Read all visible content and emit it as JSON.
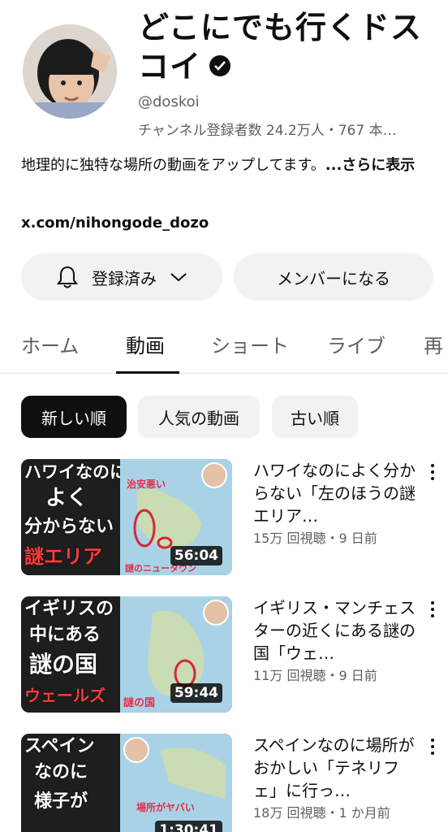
{
  "channel": {
    "name": "どこにでも行くドスコイ",
    "handle": "@doskoi",
    "stats": "チャンネル登録者数 24.2万人・767 本…",
    "description": "地理的に独特な場所の動画をアップしてます。",
    "more_label": "...さらに表示",
    "link": "x.com/nihongode_dozo"
  },
  "actions": {
    "subscribed_label": "登録済み",
    "member_label": "メンバーになる"
  },
  "tabs": [
    "ホーム",
    "動画",
    "ショート",
    "ライブ",
    "再"
  ],
  "active_tab": "動画",
  "filters": [
    "新しい順",
    "人気の動画",
    "古い順"
  ],
  "active_filter": "新しい順",
  "videos": [
    {
      "title": "ハワイなのによく分からない「左のほうの謎エリア…",
      "meta": "15万 回視聴・9 日前",
      "duration": "56:04",
      "thumb_lines": [
        "ハワイなのに",
        "よく",
        "分からない",
        "謎エリア"
      ],
      "map_labels": [
        "治安悪い",
        "謎のニュータウン"
      ]
    },
    {
      "title": "イギリス・マンチェスターの近くにある謎の国「ウェ…",
      "meta": "11万 回視聴・9 日前",
      "duration": "59:44",
      "thumb_lines": [
        "イギリスの",
        "中にある",
        "謎の国",
        "ウェールズ"
      ],
      "map_labels": [
        "謎の国"
      ]
    },
    {
      "title": "スペインなのに場所がおかしい「テネリフェ」に行っ…",
      "meta": "18万 回視聴・1 か月前",
      "duration": "1:30:41",
      "thumb_lines": [
        "スペイン",
        "なのに",
        "様子が"
      ],
      "map_labels": [
        "場所がヤバい"
      ]
    }
  ],
  "colors": {
    "text": "#0f0f0f",
    "secondary": "#606060",
    "chip_bg": "#f2f2f2",
    "thumb_red": "#ff3b3b"
  }
}
